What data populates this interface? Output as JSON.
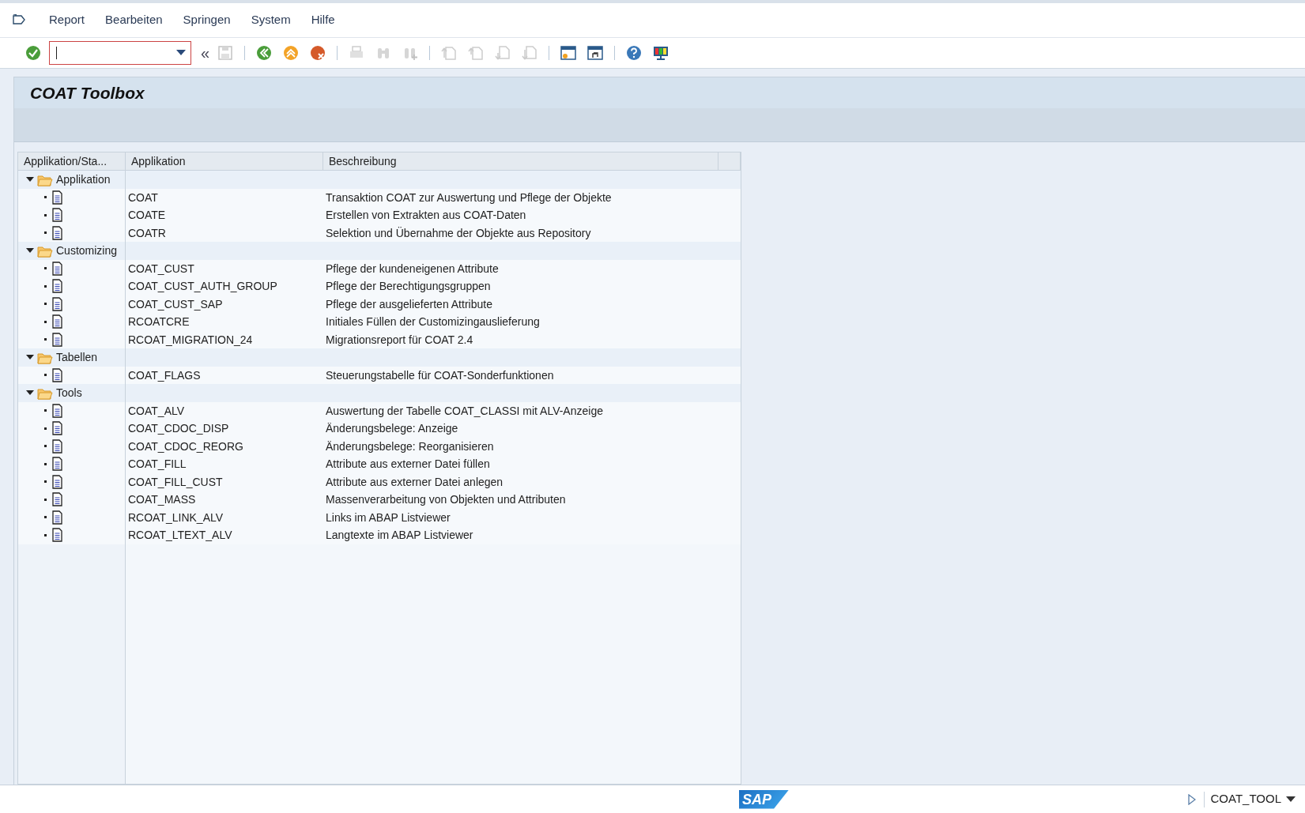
{
  "menu_bar": {
    "items": [
      "Report",
      "Bearbeiten",
      "Springen",
      "System",
      "Hilfe"
    ]
  },
  "toolbar": {
    "items": [
      {
        "kind": "enter",
        "disabled": false
      },
      {
        "kind": "field"
      },
      {
        "kind": "collapse",
        "label": "«",
        "disabled": false
      },
      {
        "kind": "save",
        "disabled": true
      },
      {
        "kind": "sep"
      },
      {
        "kind": "back",
        "disabled": false
      },
      {
        "kind": "exit",
        "disabled": false
      },
      {
        "kind": "cancel",
        "disabled": false
      },
      {
        "kind": "sep"
      },
      {
        "kind": "print",
        "disabled": true
      },
      {
        "kind": "find",
        "disabled": true
      },
      {
        "kind": "find_next",
        "disabled": true
      },
      {
        "kind": "sep"
      },
      {
        "kind": "first_page",
        "disabled": true
      },
      {
        "kind": "prev_page",
        "disabled": true
      },
      {
        "kind": "next_page",
        "disabled": true
      },
      {
        "kind": "last_page",
        "disabled": true
      },
      {
        "kind": "sep"
      },
      {
        "kind": "new_session",
        "disabled": false
      },
      {
        "kind": "shortcut",
        "disabled": false
      },
      {
        "kind": "sep"
      },
      {
        "kind": "help",
        "disabled": false
      },
      {
        "kind": "layout",
        "disabled": false
      }
    ]
  },
  "title": "COAT Toolbox",
  "table": {
    "columns": [
      "Applikation/Sta...",
      "Applikation",
      "Beschreibung"
    ],
    "groups": [
      {
        "label": "Applikation",
        "expanded": true,
        "children": [
          {
            "application": "COAT",
            "description": "Transaktion COAT zur Auswertung und Pflege der Objekte"
          },
          {
            "application": "COATE",
            "description": "Erstellen von Extrakten aus COAT-Daten"
          },
          {
            "application": "COATR",
            "description": "Selektion und Übernahme der Objekte aus Repository"
          }
        ]
      },
      {
        "label": "Customizing",
        "expanded": true,
        "children": [
          {
            "application": "COAT_CUST",
            "description": "Pflege der kundeneigenen Attribute"
          },
          {
            "application": "COAT_CUST_AUTH_GROUP",
            "description": "Pflege der Berechtigungsgruppen"
          },
          {
            "application": "COAT_CUST_SAP",
            "description": "Pflege der ausgelieferten Attribute"
          },
          {
            "application": "RCOATCRE",
            "description": "Initiales Füllen der Customizingauslieferung"
          },
          {
            "application": "RCOAT_MIGRATION_24",
            "description": "Migrationsreport für COAT 2.4"
          }
        ]
      },
      {
        "label": "Tabellen",
        "expanded": true,
        "children": [
          {
            "application": "COAT_FLAGS",
            "description": "Steuerungstabelle für COAT-Sonderfunktionen"
          }
        ]
      },
      {
        "label": "Tools",
        "expanded": true,
        "children": [
          {
            "application": "COAT_ALV",
            "description": "Auswertung der Tabelle COAT_CLASSI mit ALV-Anzeige"
          },
          {
            "application": "COAT_CDOC_DISP",
            "description": "Änderungsbelege: Anzeige"
          },
          {
            "application": "COAT_CDOC_REORG",
            "description": "Änderungsbelege: Reorganisieren"
          },
          {
            "application": "COAT_FILL",
            "description": "Attribute aus externer Datei füllen"
          },
          {
            "application": "COAT_FILL_CUST",
            "description": "Attribute aus externer Datei anlegen"
          },
          {
            "application": "COAT_MASS",
            "description": "Massenverarbeitung von Objekten und Attributen"
          },
          {
            "application": "RCOAT_LINK_ALV",
            "description": "Links im ABAP Listviewer"
          },
          {
            "application": "RCOAT_LTEXT_ALV",
            "description": "Langtexte im ABAP Listviewer"
          }
        ]
      }
    ]
  },
  "status_bar": {
    "logo": "SAP",
    "transaction": "COAT_TOOL"
  }
}
